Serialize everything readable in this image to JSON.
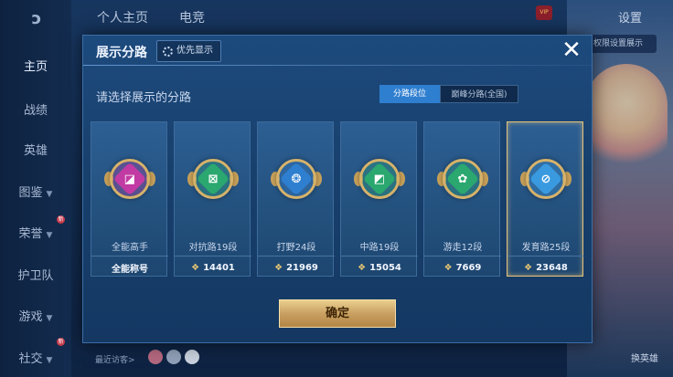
{
  "topbar": {
    "tab_profile": "个人主页",
    "tab_esports": "电竞",
    "settings": "设置",
    "vip_badge": "VIP",
    "right_button": "权限设置展示"
  },
  "sidebar": {
    "items": [
      {
        "label": "主页"
      },
      {
        "label": "战绩"
      },
      {
        "label": "英雄"
      },
      {
        "label": "图鉴"
      },
      {
        "label": "荣誉"
      },
      {
        "label": "护卫队"
      },
      {
        "label": "游戏"
      },
      {
        "label": "社交"
      }
    ],
    "badge_text": "新"
  },
  "bottom": {
    "recent_visitors": "最近访客>",
    "change_hero": "换英雄"
  },
  "modal": {
    "title": "展示分路",
    "priority_button": "优先显示",
    "close_label": "✕",
    "prompt": "请选择展示的分路",
    "segment_on": "分路段位",
    "segment_off": "巅峰分路(全国)",
    "confirm": "确定",
    "cards": [
      {
        "label": "全能高手",
        "score": "全能称号",
        "color": "#c23aa3",
        "icon": "all-round-icon",
        "glyph": "◪"
      },
      {
        "label": "对抗路19段",
        "score": "14401",
        "color": "#2aa86f",
        "icon": "clash-lane-icon",
        "glyph": "⊠"
      },
      {
        "label": "打野24段",
        "score": "21969",
        "color": "#2f7fd0",
        "icon": "jungle-icon",
        "glyph": "❂"
      },
      {
        "label": "中路19段",
        "score": "15054",
        "color": "#2aa86f",
        "icon": "mid-lane-icon",
        "glyph": "◩"
      },
      {
        "label": "游走12段",
        "score": "7669",
        "color": "#2aa86f",
        "icon": "roam-icon",
        "glyph": "✿"
      },
      {
        "label": "发育路25段",
        "score": "23648",
        "color": "#3a9ae0",
        "icon": "farm-lane-icon",
        "glyph": "⊘"
      }
    ]
  },
  "colors": {
    "accent_gold": "#d6b26a",
    "segment_active": "#2f7fd0"
  }
}
